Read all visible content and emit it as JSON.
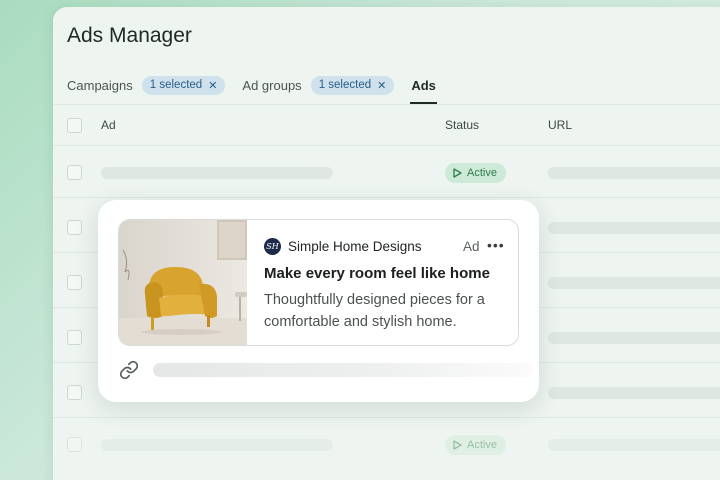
{
  "app": {
    "title": "Ads Manager"
  },
  "filters": {
    "campaigns": {
      "label": "Campaigns",
      "chip": "1 selected"
    },
    "ad_groups": {
      "label": "Ad groups",
      "chip": "1 selected"
    },
    "ads_tab": "Ads"
  },
  "table": {
    "columns": [
      "Ad",
      "Status",
      "URL"
    ],
    "status_active": "Active"
  },
  "ad_card": {
    "logo_initials": "SH",
    "brand": "Simple Home Designs",
    "ad_label": "Ad",
    "headline": "Make every room feel like home",
    "description": "Thoughtfully designed pieces for a comfortable and stylish home."
  },
  "icons": {
    "chip_close": "close-icon",
    "status": "play-icon",
    "more": "more-horizontal-icon",
    "link": "link-icon"
  },
  "colors": {
    "accent_chip_bg": "#cfe1ec",
    "accent_chip_text": "#2a5d88",
    "status_active_bg": "#cde9d7",
    "status_active_text": "#2f7d4d",
    "brand_logo": "#1c2b4a",
    "chair": "#d9a42e"
  }
}
